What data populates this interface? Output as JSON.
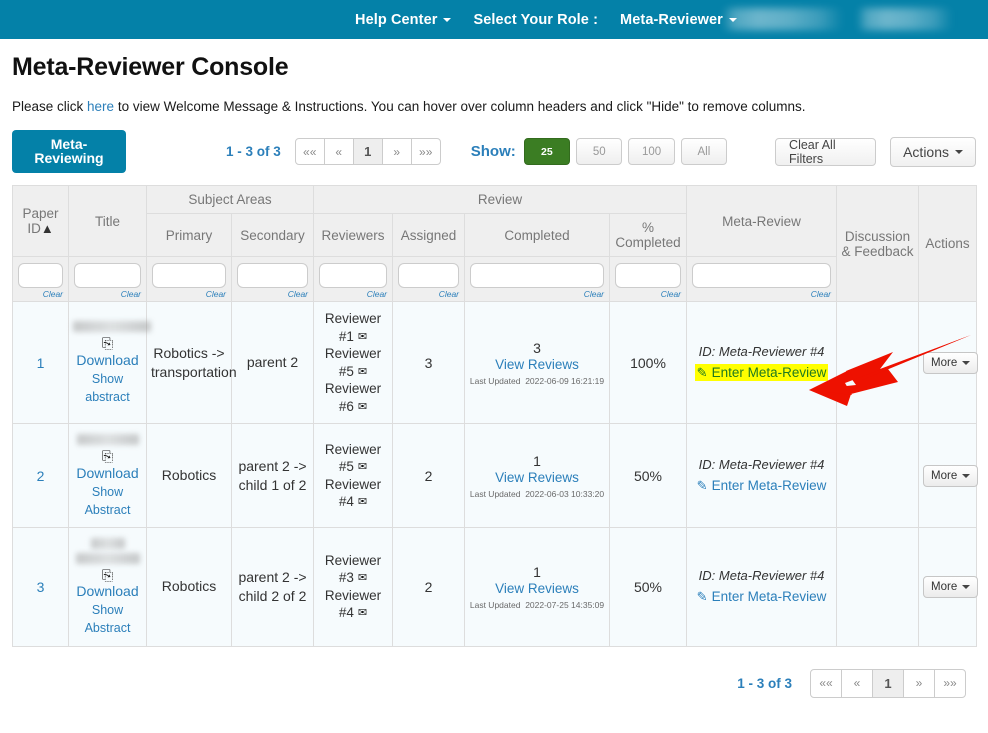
{
  "navbar": {
    "items": [
      {
        "label": "Help Center",
        "caret": true
      },
      {
        "label": "Select Your Role :",
        "caret": false
      },
      {
        "label": "Meta-Reviewer",
        "caret": true
      }
    ],
    "redacted_1": "",
    "redacted_2": "",
    "bg_color": "#0481a8"
  },
  "header": {
    "title": "Meta-Reviewer Console",
    "instructions_prefix": "Please click ",
    "instructions_link": "here",
    "instructions_suffix": " to view Welcome Message & Instructions. You can hover over column headers and click \"Hide\" to remove columns."
  },
  "toolbar": {
    "tag_label": "Meta-Reviewing",
    "result_count": "1 - 3 of 3",
    "pager": [
      "««",
      "«",
      "1",
      "»",
      "»»"
    ],
    "pager_active": "1",
    "show_label": "Show:",
    "page_sizes": [
      "25",
      "50",
      "100",
      "All"
    ],
    "page_size_selected": "25",
    "clear_filters_label": "Clear All Filters",
    "actions_label": "Actions"
  },
  "table": {
    "group_headers": [
      {
        "label": "Subject Areas"
      },
      {
        "label": "Review"
      }
    ],
    "columns": [
      {
        "key": "paper_id",
        "label": "Paper ID",
        "sort": "▲",
        "filter": true,
        "clear": "Clear"
      },
      {
        "key": "title",
        "label": "Title",
        "filter": true,
        "clear": "Clear"
      },
      {
        "key": "primary",
        "label": "Primary",
        "filter": true,
        "clear": "Clear"
      },
      {
        "key": "secondary",
        "label": "Secondary",
        "filter": true,
        "clear": "Clear"
      },
      {
        "key": "reviewers",
        "label": "Reviewers",
        "filter": true,
        "clear": "Clear"
      },
      {
        "key": "assigned",
        "label": "Assigned",
        "filter": true,
        "clear": "Clear"
      },
      {
        "key": "completed",
        "label": "Completed",
        "filter": true,
        "clear": "Clear"
      },
      {
        "key": "pct_completed",
        "label": "% Completed",
        "filter": true,
        "clear": "Clear"
      },
      {
        "key": "meta_review",
        "label": "Meta-Review",
        "filter": true,
        "clear": "Clear"
      },
      {
        "key": "discussion",
        "label": "Discussion & Feedback",
        "filter": false
      },
      {
        "key": "actions",
        "label": "Actions",
        "filter": false
      }
    ],
    "rows": [
      {
        "paper_id": "1",
        "title_redacted": true,
        "download_label": "Download",
        "show_abstract_line1": "Show",
        "show_abstract_line2": "abstract",
        "primary": "Robotics -> transportation",
        "secondary": "parent 2",
        "reviewers": [
          "Reviewer #1",
          "Reviewer #5",
          "Reviewer #6"
        ],
        "assigned": "3",
        "completed_count": "3",
        "view_reviews_label": "View Reviews",
        "last_updated_label": "Last Updated",
        "last_updated_value": "2022-06-09 16:21:19",
        "pct_completed": "100%",
        "meta_review_id": "ID: Meta-Reviewer #4",
        "enter_meta_review_label": "Enter Meta-Review",
        "enter_meta_review_highlighted": true,
        "discussion": "",
        "more_label": "More"
      },
      {
        "paper_id": "2",
        "title_redacted": true,
        "download_label": "Download",
        "show_abstract_line1": "Show",
        "show_abstract_line2": "Abstract",
        "primary": "Robotics",
        "secondary": "parent 2 -> child 1 of 2",
        "reviewers": [
          "Reviewer #5",
          "Reviewer #4"
        ],
        "assigned": "2",
        "completed_count": "1",
        "view_reviews_label": "View Reviews",
        "last_updated_label": "Last Updated",
        "last_updated_value": "2022-06-03 10:33:20",
        "pct_completed": "50%",
        "meta_review_id": "ID: Meta-Reviewer #4",
        "enter_meta_review_label": "Enter Meta-Review",
        "enter_meta_review_highlighted": false,
        "discussion": "",
        "more_label": "More"
      },
      {
        "paper_id": "3",
        "title_redacted": true,
        "download_label": "Download",
        "show_abstract_line1": "Show",
        "show_abstract_line2": "Abstract",
        "primary": "Robotics",
        "secondary": "parent 2 -> child 2 of 2",
        "reviewers": [
          "Reviewer #3",
          "Reviewer #4"
        ],
        "assigned": "2",
        "completed_count": "1",
        "view_reviews_label": "View Reviews",
        "last_updated_label": "Last Updated",
        "last_updated_value": "2022-07-25 14:35:09",
        "pct_completed": "50%",
        "meta_review_id": "ID: Meta-Reviewer #4",
        "enter_meta_review_label": "Enter Meta-Review",
        "enter_meta_review_highlighted": false,
        "discussion": "",
        "more_label": "More"
      }
    ]
  },
  "bottom": {
    "result_count": "1 - 3 of 3",
    "pager": [
      "««",
      "«",
      "1",
      "»",
      "»»"
    ],
    "pager_active": "1"
  },
  "annotation": {
    "arrow_color": "#ee1100",
    "highlight_color": "#ffff00"
  }
}
